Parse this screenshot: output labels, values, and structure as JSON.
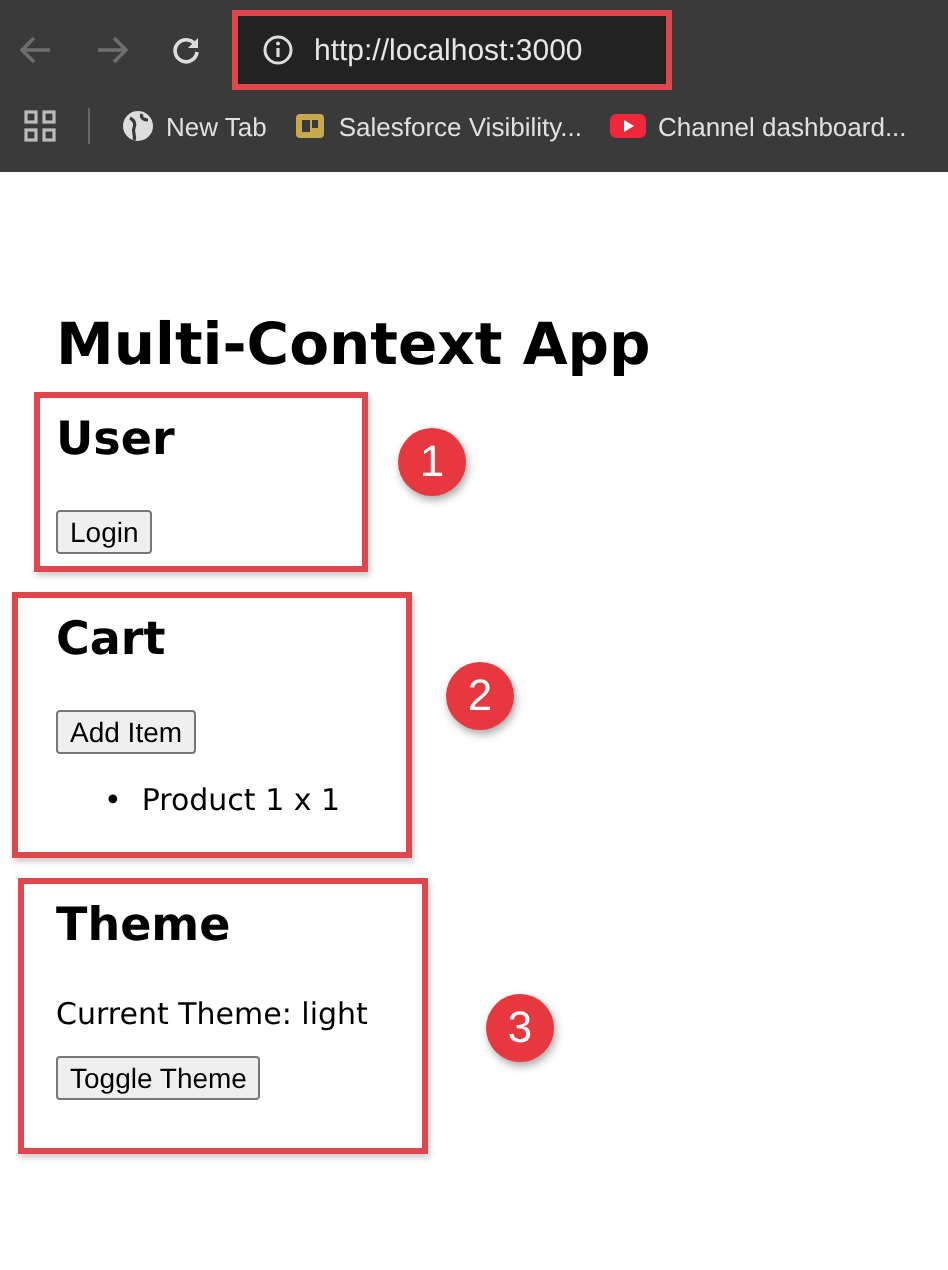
{
  "browser": {
    "url": "http://localhost:3000",
    "bookmarks": [
      {
        "label": "New Tab",
        "kind": "globe"
      },
      {
        "label": "Salesforce Visibility...",
        "kind": "logo"
      },
      {
        "label": "Channel dashboard...",
        "kind": "video"
      }
    ]
  },
  "page": {
    "title": "Multi-Context App",
    "sections": [
      {
        "heading": "User",
        "badge": "1",
        "blocks": [
          {
            "kind": "button",
            "text": "Login"
          }
        ]
      },
      {
        "heading": "Cart",
        "badge": "2",
        "blocks": [
          {
            "kind": "button",
            "text": "Add Item"
          },
          {
            "kind": "list",
            "marker": "•",
            "items": [
              "Product 1 x 1"
            ]
          }
        ]
      },
      {
        "heading": "Theme",
        "badge": "3",
        "blocks": [
          {
            "kind": "paragraph",
            "text": "Current Theme: light"
          },
          {
            "kind": "button",
            "text": "Toggle Theme"
          }
        ]
      }
    ]
  }
}
